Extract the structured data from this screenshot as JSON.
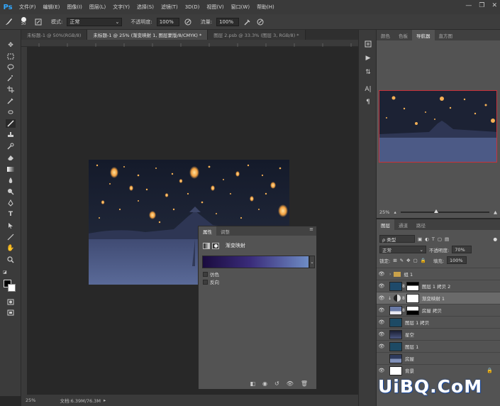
{
  "app": {
    "logo": "Ps",
    "window_controls": [
      "—",
      "❐",
      "✕"
    ]
  },
  "menu": [
    "文件(F)",
    "编辑(E)",
    "图像(I)",
    "图层(L)",
    "文字(Y)",
    "选择(S)",
    "滤镜(T)",
    "3D(D)",
    "视图(V)",
    "窗口(W)",
    "帮助(H)"
  ],
  "options": {
    "brush_size": "30",
    "mode_label": "模式:",
    "mode_value": "正常",
    "opacity_label": "不透明度:",
    "opacity_value": "100%",
    "flow_label": "流量:",
    "flow_value": "100%"
  },
  "tabs": [
    "未标题-1 @ 50%(RGB/8)",
    "未标题-1 @ 25% (渐变映射 1, 图层蒙版/8/CMYK) *",
    "图层 2.psb @ 33.3% (图层 3, RGB/8) *"
  ],
  "status": {
    "zoom": "25%",
    "doc": "文档:6.39M/76.3M"
  },
  "properties": {
    "tabs": [
      "属性",
      "调整"
    ],
    "title": "渐变映射",
    "dither": "仿色",
    "reverse": "反向"
  },
  "top_panel": {
    "tabs": [
      "颜色",
      "色板",
      "导航器",
      "直方图"
    ],
    "zoom": "25%"
  },
  "layers": {
    "tabs": [
      "图层",
      "通道",
      "路径"
    ],
    "kind": "ρ 类型",
    "blend": "正常",
    "opacity_label": "不透明度:",
    "opacity": "70%",
    "lock_label": "锁定:",
    "fill_label": "填充:",
    "fill": "100%",
    "items": [
      {
        "name": "组 1",
        "type": "group",
        "visible": true
      },
      {
        "name": "图层 1 拷贝 2",
        "type": "mask",
        "visible": true
      },
      {
        "name": "渐变映射 1",
        "type": "adjust",
        "visible": true,
        "selected": true
      },
      {
        "name": "房屋 拷贝",
        "type": "mask2",
        "visible": true
      },
      {
        "name": "图层 1 拷贝",
        "type": "image",
        "visible": true
      },
      {
        "name": "星空",
        "type": "image",
        "visible": true
      },
      {
        "name": "图层 1",
        "type": "image",
        "visible": true
      },
      {
        "name": "房屋",
        "type": "image",
        "visible": false
      },
      {
        "name": "背景",
        "type": "white",
        "visible": true
      }
    ]
  },
  "watermark": "UiBQ.CoM",
  "colors": {
    "accent": "#31a8ff",
    "panel": "#535353",
    "chrome": "#3b3b3b",
    "canvas": "#282828"
  }
}
